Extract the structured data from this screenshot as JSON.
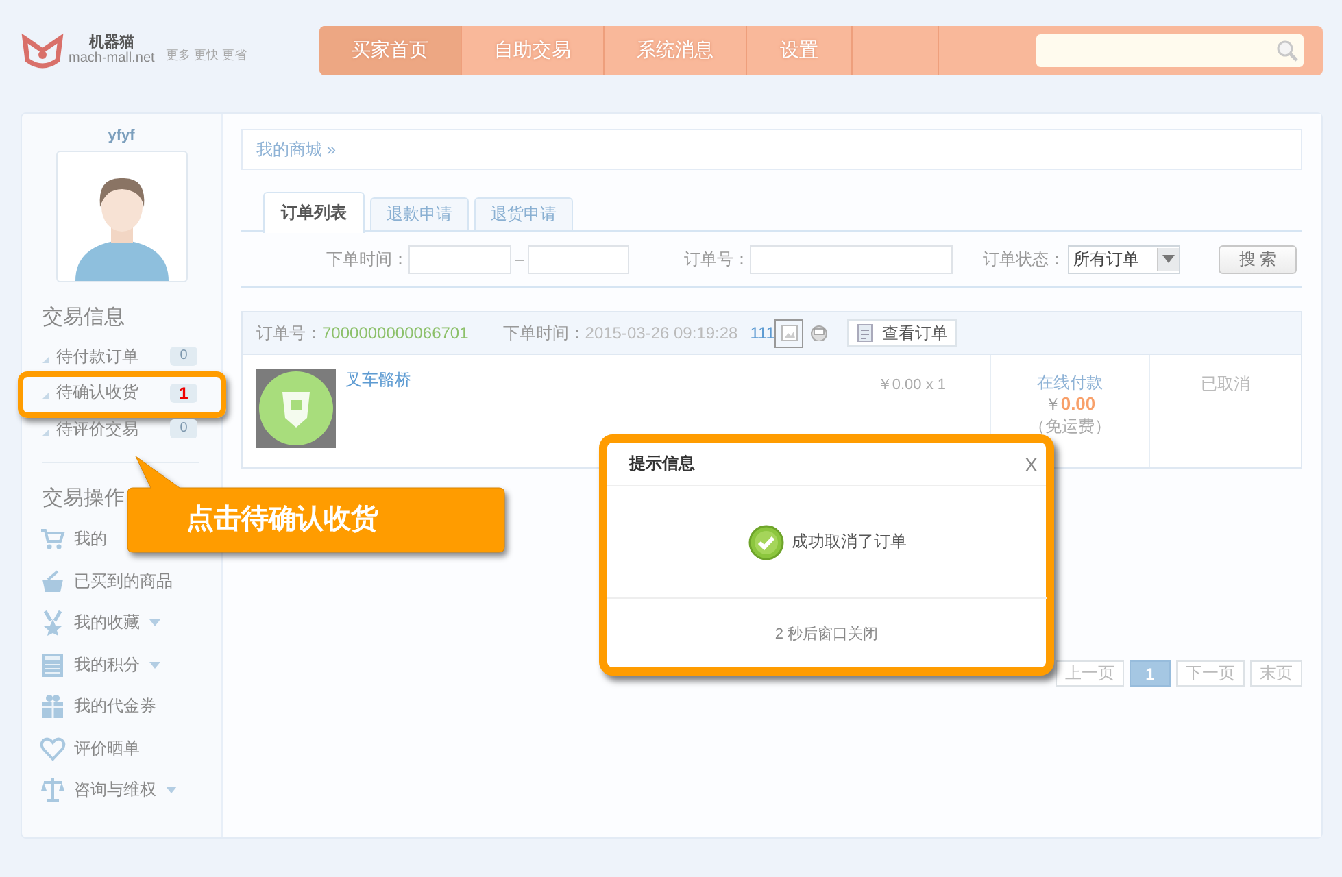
{
  "header": {
    "logo": {
      "name": "机器猫",
      "domain": "mach-mall.net",
      "slogan": "更多 更快 更省"
    },
    "nav": [
      {
        "label": "买家首页",
        "selected": true
      },
      {
        "label": "自助交易",
        "selected": false
      },
      {
        "label": "系统消息",
        "selected": false
      },
      {
        "label": "设置",
        "selected": false
      }
    ]
  },
  "sidebar": {
    "username": "yfyf",
    "info": {
      "title": "交易信息",
      "items": [
        {
          "label": "待付款订单",
          "count": "0",
          "alert": false,
          "highlighted": false
        },
        {
          "label": "待确认收货",
          "count": "1",
          "alert": true,
          "highlighted": true
        },
        {
          "label": "待评价交易",
          "count": "0",
          "alert": false,
          "highlighted": false
        }
      ]
    },
    "actions": {
      "title": "交易操作",
      "items": [
        {
          "label": "我的",
          "kind": "cart",
          "has_menu": false
        },
        {
          "label": "已买到的商品",
          "kind": "basket",
          "has_menu": false
        },
        {
          "label": "我的收藏",
          "kind": "medal",
          "has_menu": true
        },
        {
          "label": "我的积分",
          "kind": "calculator",
          "has_menu": true
        },
        {
          "label": "我的代金券",
          "kind": "gift",
          "has_menu": false
        },
        {
          "label": "评价晒单",
          "kind": "heart",
          "has_menu": false
        },
        {
          "label": "咨询与维权",
          "kind": "scale",
          "has_menu": true
        }
      ]
    }
  },
  "main": {
    "breadcrumb": "我的商城 »",
    "tabs": [
      {
        "label": "订单列表",
        "selected": true
      },
      {
        "label": "退款申请",
        "selected": false
      },
      {
        "label": "退货申请",
        "selected": false
      }
    ],
    "filters": {
      "date_label": "下单时间：",
      "range_separator": "–",
      "order_no_label": "订单号：",
      "status_label": "订单状态：",
      "status_value": "所有订单",
      "search_button": "搜 索"
    },
    "orders": [
      {
        "no_label": "订单号：",
        "no": "7000000000066701",
        "time_label": "下单时间：",
        "time": "2015-03-26 09:19:28",
        "code": "111",
        "view_button": "查看订单",
        "items": [
          {
            "name": "叉车骼桥",
            "price": "￥0.00 x 1"
          }
        ],
        "payment": "在线付款",
        "currency": "￥",
        "total": "0.00",
        "shipping": "（免运费）",
        "status": "已取消"
      }
    ],
    "pagination": [
      {
        "label": "上一页",
        "selected": false
      },
      {
        "label": "1",
        "selected": true
      },
      {
        "label": "下一页",
        "selected": false
      },
      {
        "label": "末页",
        "selected": false
      }
    ]
  },
  "dialog": {
    "title": "提示信息",
    "close": "X",
    "message": "成功取消了订单",
    "footer": "2 秒后窗口关闭"
  },
  "callout": {
    "text": "点击待确认收货"
  }
}
